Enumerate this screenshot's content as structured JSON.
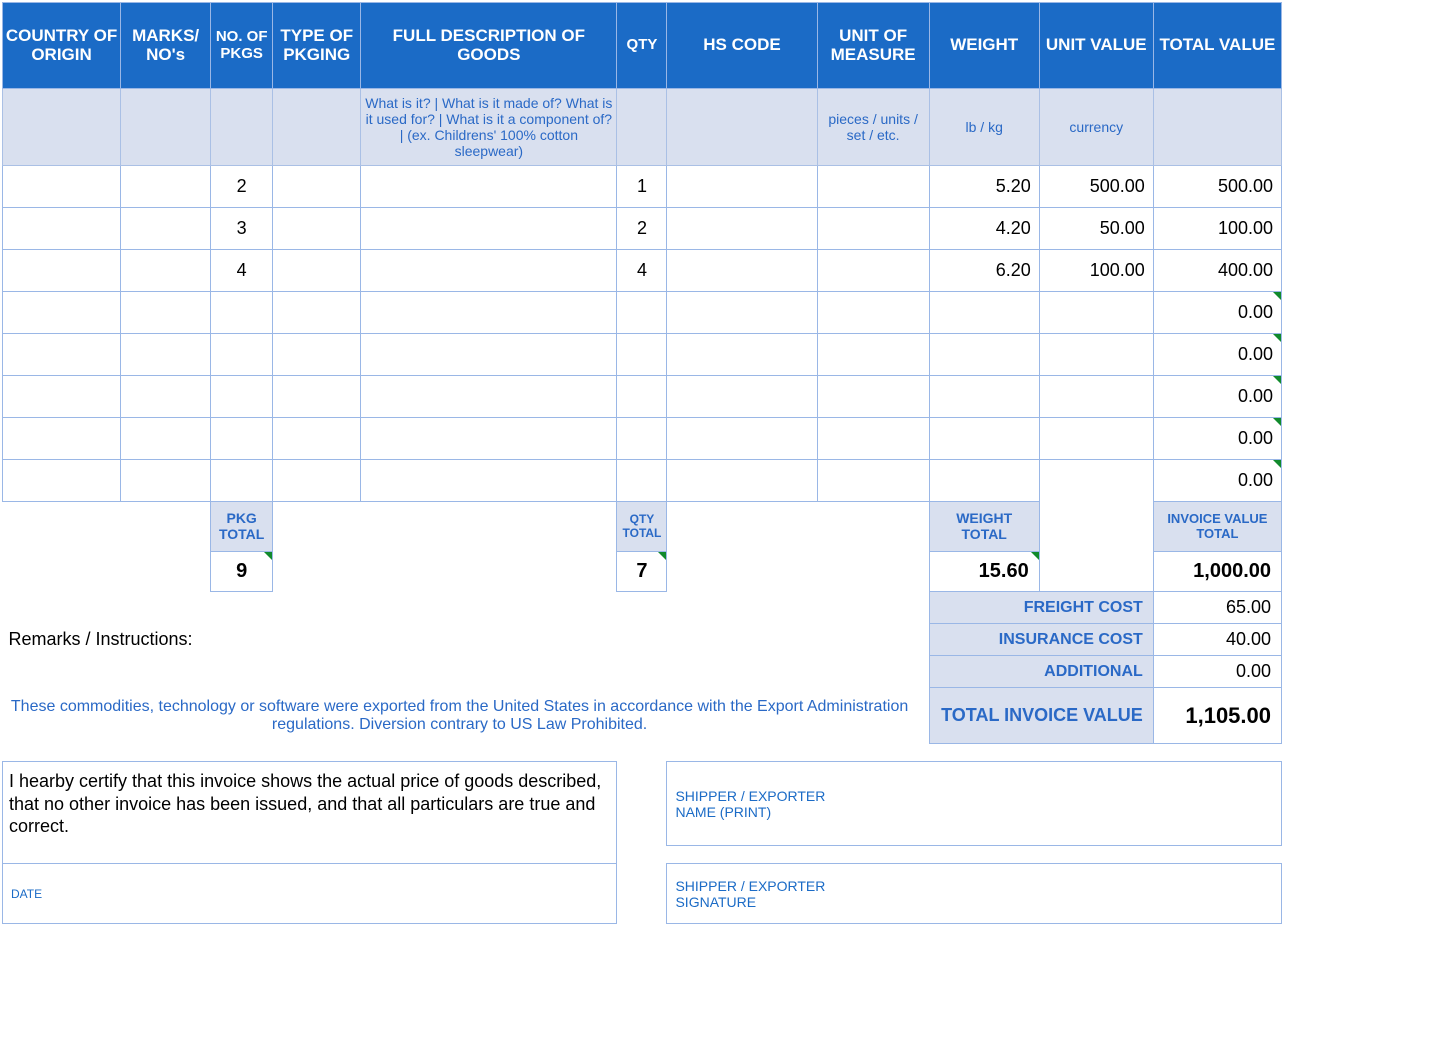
{
  "headers": {
    "country": "COUNTRY OF ORIGIN",
    "marks": "MARKS/ NO's",
    "pkgs": "NO. OF PKGS",
    "pkging": "TYPE OF PKGING",
    "desc": "FULL DESCRIPTION OF GOODS",
    "qty": "QTY",
    "hs": "HS CODE",
    "uom": "UNIT OF MEASURE",
    "weight": "WEIGHT",
    "uval": "UNIT VALUE",
    "tval": "TOTAL VALUE"
  },
  "hints": {
    "desc": "What is it? | What is it made of? What is it used for? | What is it a component of? | (ex. Childrens' 100% cotton sleepwear)",
    "uom": "pieces / units / set / etc.",
    "weight": "lb / kg",
    "uval": "currency"
  },
  "rows": [
    {
      "pkgs": "2",
      "qty": "1",
      "weight": "5.20",
      "uval": "500.00",
      "tval": "500.00"
    },
    {
      "pkgs": "3",
      "qty": "2",
      "weight": "4.20",
      "uval": "50.00",
      "tval": "100.00"
    },
    {
      "pkgs": "4",
      "qty": "4",
      "weight": "6.20",
      "uval": "100.00",
      "tval": "400.00"
    },
    {
      "tval": "0.00",
      "tri": true
    },
    {
      "tval": "0.00",
      "tri": true
    },
    {
      "tval": "0.00",
      "tri": true
    },
    {
      "tval": "0.00",
      "tri": true
    },
    {
      "tval": "0.00",
      "tri": true
    }
  ],
  "subheaders": {
    "pkg": "PKG TOTAL",
    "qty": "QTY TOTAL",
    "weight": "WEIGHT TOTAL",
    "inv": "INVOICE VALUE TOTAL"
  },
  "totals": {
    "pkg": "9",
    "qty": "7",
    "weight": "15.60",
    "inv": "1,000.00"
  },
  "remarks_label": "Remarks / Instructions:",
  "costs": {
    "freight_label": "FREIGHT COST",
    "freight": "65.00",
    "insurance_label": "INSURANCE COST",
    "insurance": "40.00",
    "additional_label": "ADDITIONAL",
    "additional": "0.00",
    "totinv_label": "TOTAL INVOICE VALUE",
    "totinv": "1,105.00"
  },
  "legal": "These commodities, technology or software were exported from the United States in accordance with the Export Administration regulations.  Diversion contrary to US Law Prohibited.",
  "certify": "I hearby certify that this invoice shows the actual price of goods described, that no other invoice has been issued, and that all particulars are true and correct.",
  "sig": {
    "name1": "SHIPPER / EXPORTER",
    "name2": "NAME (PRINT)",
    "sig1": "SHIPPER / EXPORTER",
    "sig2": "SIGNATURE",
    "date": "DATE"
  }
}
